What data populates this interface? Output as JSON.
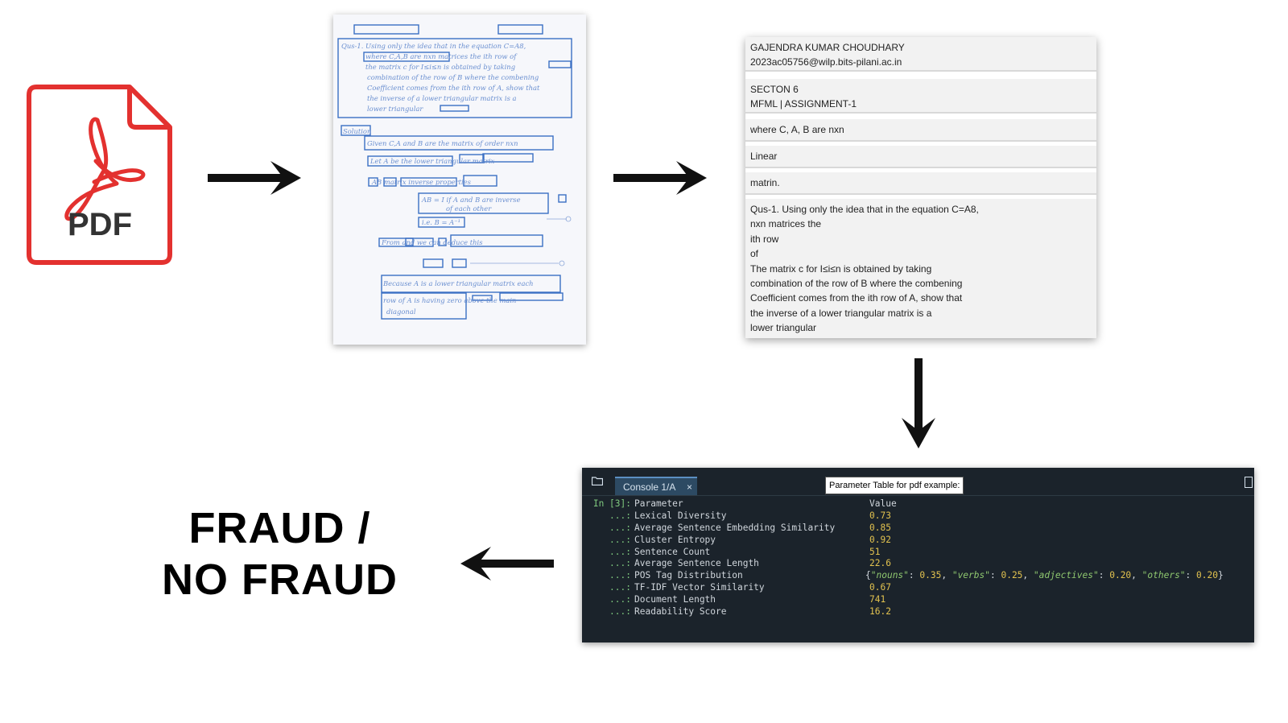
{
  "pdf_icon": {
    "label": "PDF",
    "color": "#e3312f"
  },
  "extracted": {
    "blocks": [
      {
        "lines": [
          "GAJENDRA KUMAR CHOUDHARY",
          "2023ac05756@wilp.bits-pilani.ac.in"
        ]
      },
      {
        "lines": [
          "SECTON 6",
          "MFML | ASSIGNMENT-1"
        ]
      },
      {
        "lines": [
          "where C, A, B are nxn"
        ]
      },
      {
        "lines": [
          "Linear"
        ]
      },
      {
        "lines": [
          "matrin."
        ]
      },
      {
        "lines": [
          "Qus-1. Using only the idea that in the equation C=A8,",
          "nxn matrices the",
          "ith row",
          "of",
          "The matrix c for I≤i≤n is obtained by taking",
          "combination of the row of B where the combening",
          "Coefficient comes from the ith row of A, show that",
          "the inverse of a lower triangular matrix is a",
          "lower triangular"
        ]
      }
    ]
  },
  "console": {
    "tab_label": "Console 1/A",
    "tab_close": "×",
    "caption": "Parameter Table for pdf example:",
    "prompt_first": "In [3]:",
    "prompt_cont": "...:",
    "header": {
      "name": "Parameter",
      "value": "Value"
    },
    "rows": [
      {
        "name": "Lexical Diversity",
        "value": "0.73"
      },
      {
        "name": "Average Sentence Embedding Similarity",
        "value": "0.85"
      },
      {
        "name": "Cluster Entropy",
        "value": "0.92"
      },
      {
        "name": "Sentence Count",
        "value": "51"
      },
      {
        "name": "Average Sentence Length",
        "value": "22.6"
      },
      {
        "name": "POS Tag Distribution",
        "value": "{\"nouns\": 0.35, \"verbs\": 0.25, \"adjectives\": 0.20, \"others\": 0.20}"
      },
      {
        "name": "TF-IDF Vector Similarity",
        "value": "0.67"
      },
      {
        "name": "Document Length",
        "value": "741"
      },
      {
        "name": "Readability Score",
        "value": "16.2"
      }
    ],
    "pos_tags": [
      {
        "key": "\"nouns\"",
        "val": "0.35"
      },
      {
        "key": "\"verbs\"",
        "val": "0.25"
      },
      {
        "key": "\"adjectives\"",
        "val": "0.20"
      },
      {
        "key": "\"others\"",
        "val": "0.20"
      }
    ]
  },
  "verdict": {
    "line1": "FRAUD /",
    "line2": "NO FRAUD"
  }
}
